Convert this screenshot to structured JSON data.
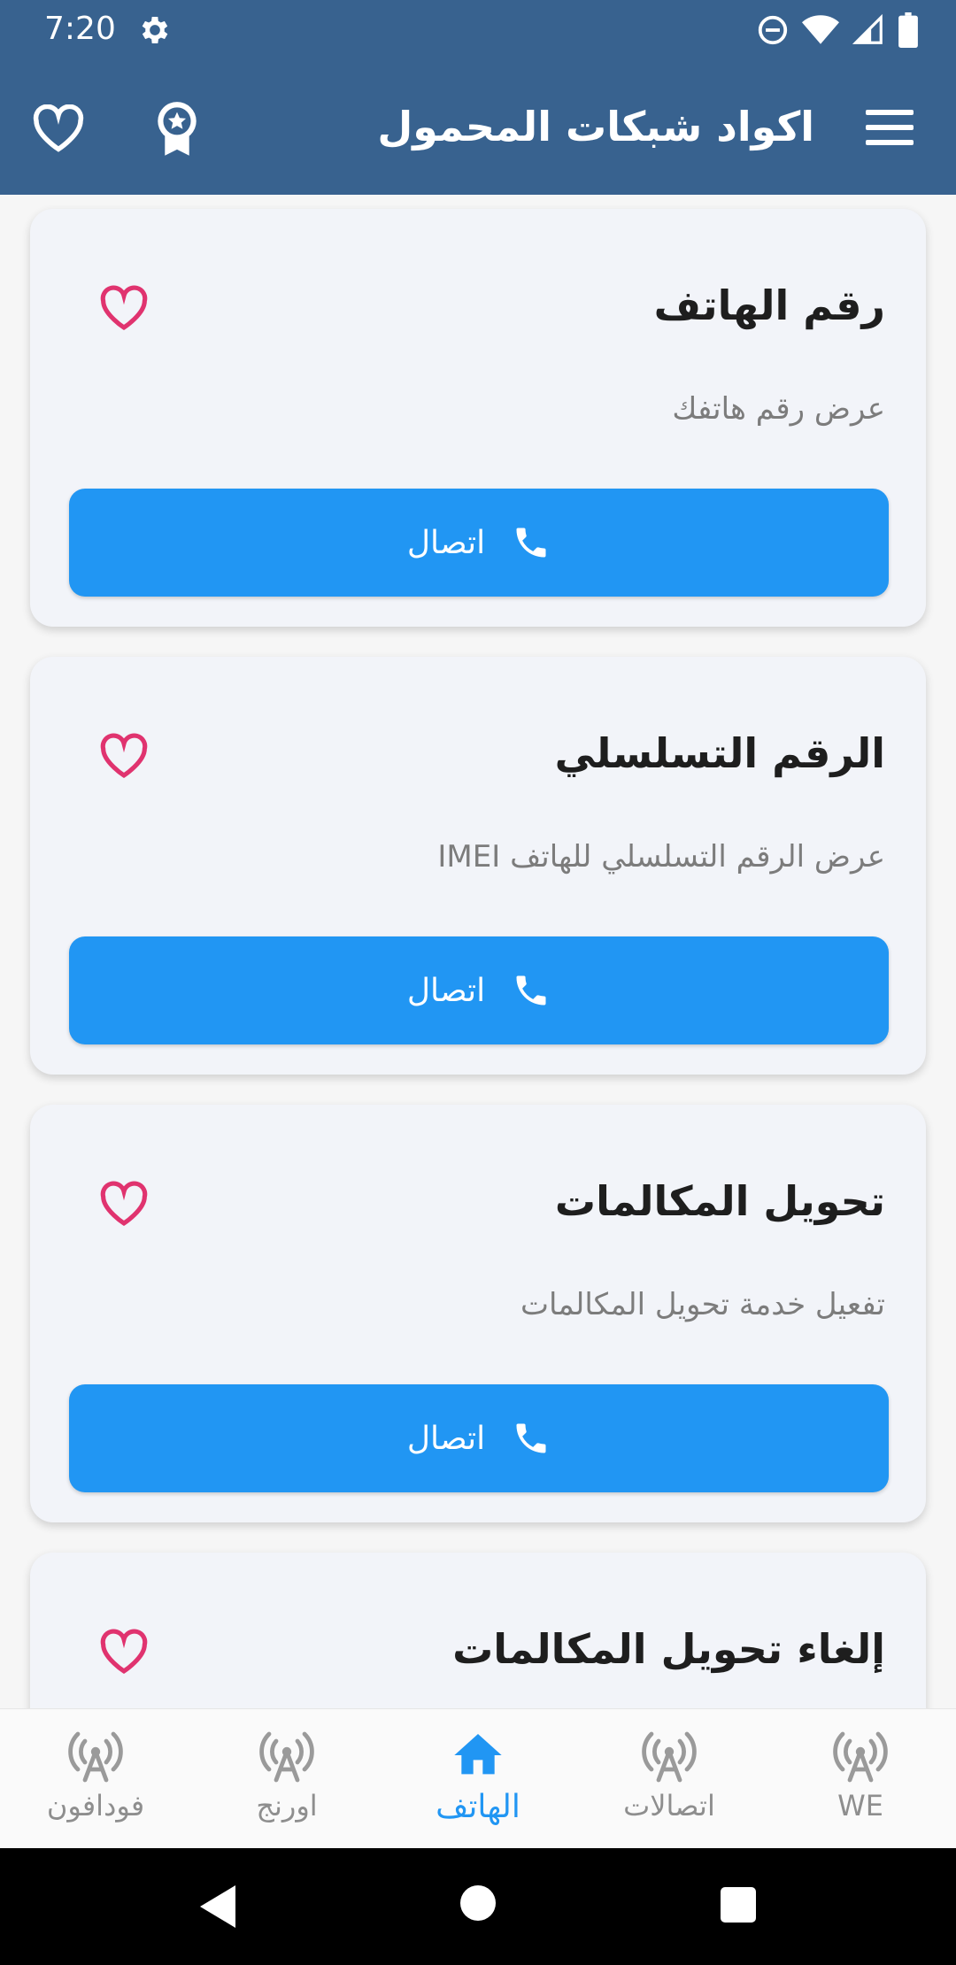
{
  "status_bar": {
    "time": "7:20"
  },
  "app_bar": {
    "title": "اكواد شبكات المحمول"
  },
  "cards": [
    {
      "title": "رقم الهاتف",
      "description": "عرض رقم هاتفك",
      "button_label": "اتصال"
    },
    {
      "title": "الرقم التسلسلي",
      "description": "عرض الرقم التسلسلي للهاتف IMEI",
      "button_label": "اتصال"
    },
    {
      "title": "تحويل المكالمات",
      "description": "تفعيل خدمة تحويل المكالمات",
      "button_label": "اتصال"
    },
    {
      "title": "إلغاء تحويل المكالمات",
      "description": "",
      "button_label": ""
    }
  ],
  "bottom_nav": {
    "items": [
      {
        "label": "فودافون",
        "icon": "antenna-icon",
        "active": false
      },
      {
        "label": "اورنج",
        "icon": "antenna-icon",
        "active": false
      },
      {
        "label": "الهاتف",
        "icon": "home-icon",
        "active": true
      },
      {
        "label": "اتصالات",
        "icon": "antenna-icon",
        "active": false
      },
      {
        "label": "WE",
        "icon": "antenna-icon",
        "active": false
      }
    ]
  },
  "colors": {
    "primary": "#38628f",
    "accent": "#2196f3",
    "heart": "#e0336f",
    "inactive": "#8e8e8e"
  }
}
